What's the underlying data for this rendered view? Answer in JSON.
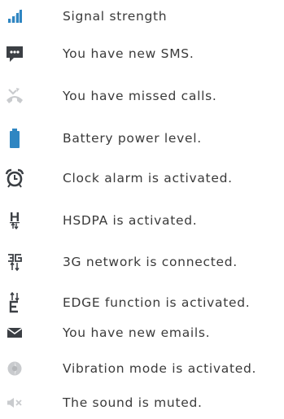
{
  "legend": [
    {
      "icon": "signal-strength-icon",
      "label": "Signal strength"
    },
    {
      "icon": "new-sms-icon",
      "label": "You have new SMS."
    },
    {
      "icon": "missed-call-icon",
      "label": "You have missed calls."
    },
    {
      "icon": "battery-icon",
      "label": "Battery power level."
    },
    {
      "icon": "alarm-clock-icon",
      "label": "Clock alarm is activated."
    },
    {
      "icon": "hsdpa-icon",
      "label": "HSDPA is activated."
    },
    {
      "icon": "3g-network-icon",
      "label": "3G network is connected."
    },
    {
      "icon": "edge-icon",
      "label": "EDGE function is activated."
    },
    {
      "icon": "email-icon",
      "label": "You have new emails."
    },
    {
      "icon": "vibration-icon",
      "label": "Vibration mode is activated."
    },
    {
      "icon": "mute-icon",
      "label": "The sound is muted."
    }
  ],
  "colors": {
    "text": "#3a3a3a",
    "accent_blue": "#2f86c2",
    "icon_dark": "#3b3f44",
    "icon_light": "#c9cbce"
  }
}
